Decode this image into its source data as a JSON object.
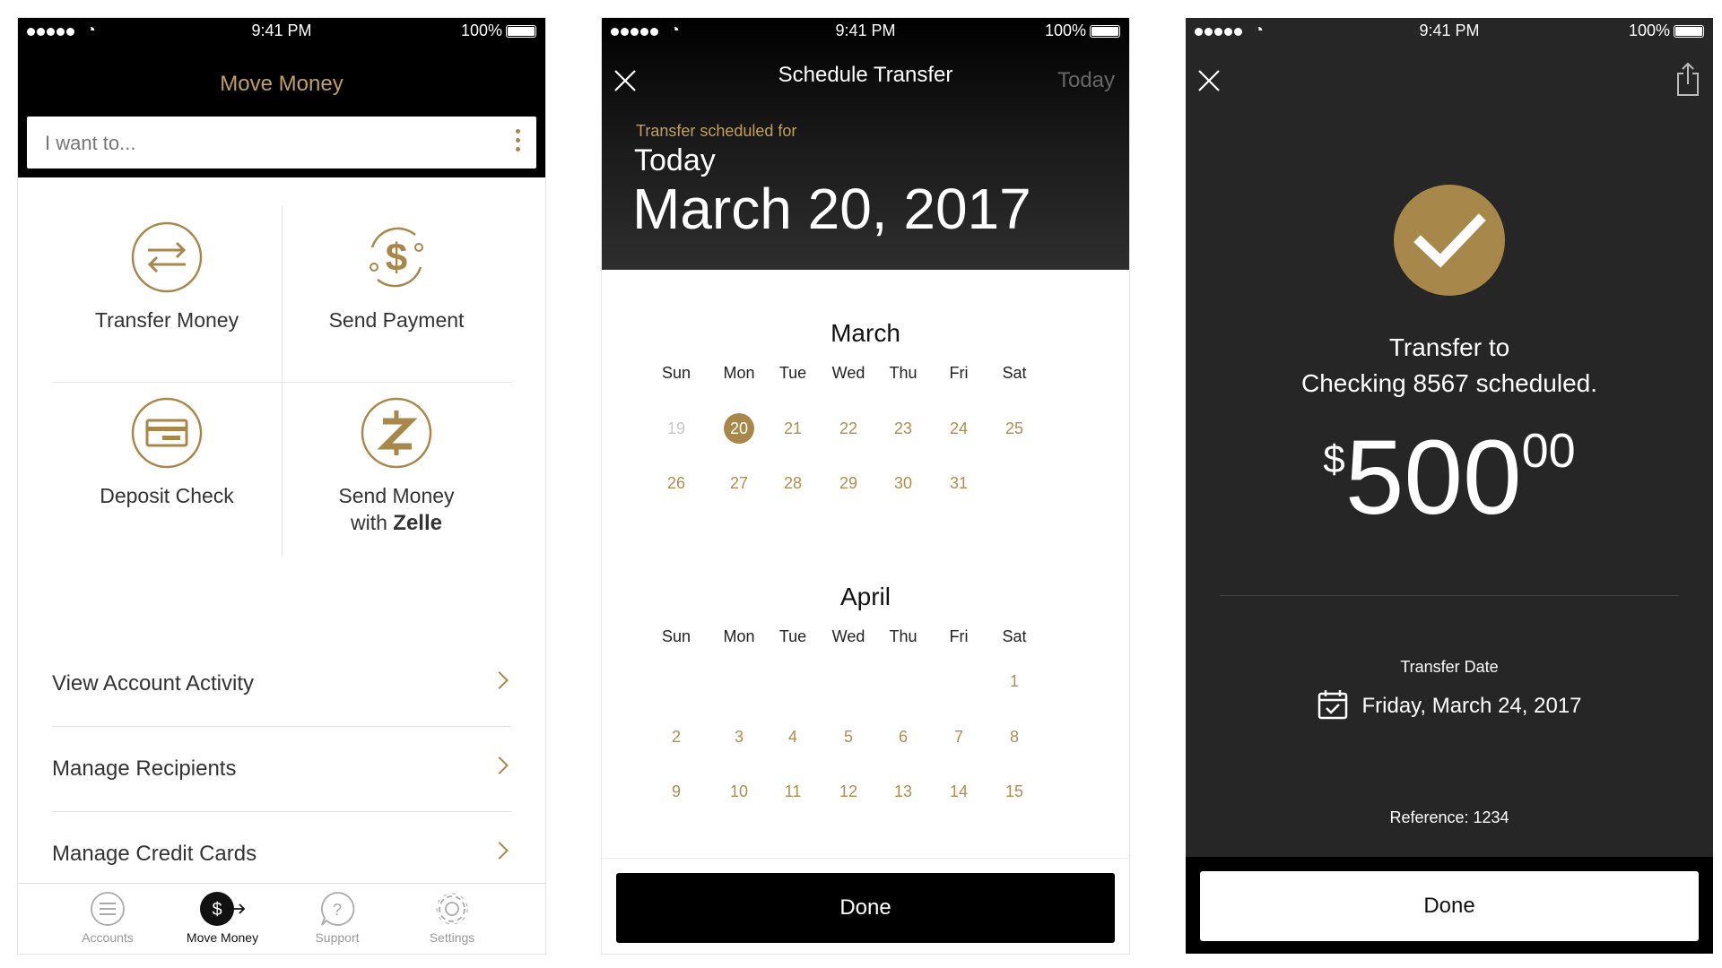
{
  "status_bar": {
    "time": "9:41 PM",
    "battery": "100%"
  },
  "colors": {
    "gold": "#a8874a",
    "gold_text": "#c0a062",
    "dark_bg": "#262626"
  },
  "move_money": {
    "title": "Move Money",
    "search_placeholder": "I want to...",
    "tiles": [
      {
        "label": "Transfer Money",
        "icon": "transfer-arrows-icon"
      },
      {
        "label": "Send Payment",
        "icon": "dollar-sign-icon"
      },
      {
        "label": "Deposit Check",
        "icon": "check-icon"
      },
      {
        "label_line1": "Send Money",
        "label_line2_prefix": "with",
        "label_line2_brand": "Zelle",
        "icon": "zelle-icon"
      }
    ],
    "list": [
      {
        "label": "View Account Activity"
      },
      {
        "label": "Manage Recipients"
      },
      {
        "label": "Manage Credit Cards"
      }
    ],
    "tabs": [
      {
        "label": "Accounts",
        "icon": "list-icon"
      },
      {
        "label": "Move Money",
        "icon": "dollar-transfer-icon",
        "active": true
      },
      {
        "label": "Support",
        "icon": "chat-question-icon"
      },
      {
        "label": "Settings",
        "icon": "gear-icon"
      }
    ]
  },
  "schedule": {
    "title": "Schedule Transfer",
    "today_button": "Today",
    "scheduled_for_label": "Transfer scheduled for",
    "scheduled_today": "Today",
    "scheduled_date": "March 20, 2017",
    "weekdays": [
      "Sun",
      "Mon",
      "Tue",
      "Wed",
      "Thu",
      "Fri",
      "Sat"
    ],
    "months": [
      {
        "name": "March",
        "rows": [
          [
            "19",
            "20",
            "21",
            "22",
            "23",
            "24",
            "25"
          ],
          [
            "26",
            "27",
            "28",
            "29",
            "30",
            "31",
            ""
          ]
        ],
        "past_days": [
          "19"
        ],
        "selected_day": "20"
      },
      {
        "name": "April",
        "rows": [
          [
            "",
            "",
            "",
            "",
            "",
            "",
            "1"
          ],
          [
            "2",
            "3",
            "4",
            "5",
            "6",
            "7",
            "8"
          ],
          [
            "9",
            "10",
            "11",
            "12",
            "13",
            "14",
            "15"
          ]
        ]
      }
    ],
    "done_label": "Done"
  },
  "confirmation": {
    "message_line1": "Transfer to",
    "message_line2": "Checking 8567 scheduled.",
    "amount_currency": "$",
    "amount_dollars": "500",
    "amount_cents": "00",
    "transfer_date_label": "Transfer Date",
    "transfer_date_value": "Friday, March 24, 2017",
    "reference": "Reference: 1234",
    "done_label": "Done"
  }
}
